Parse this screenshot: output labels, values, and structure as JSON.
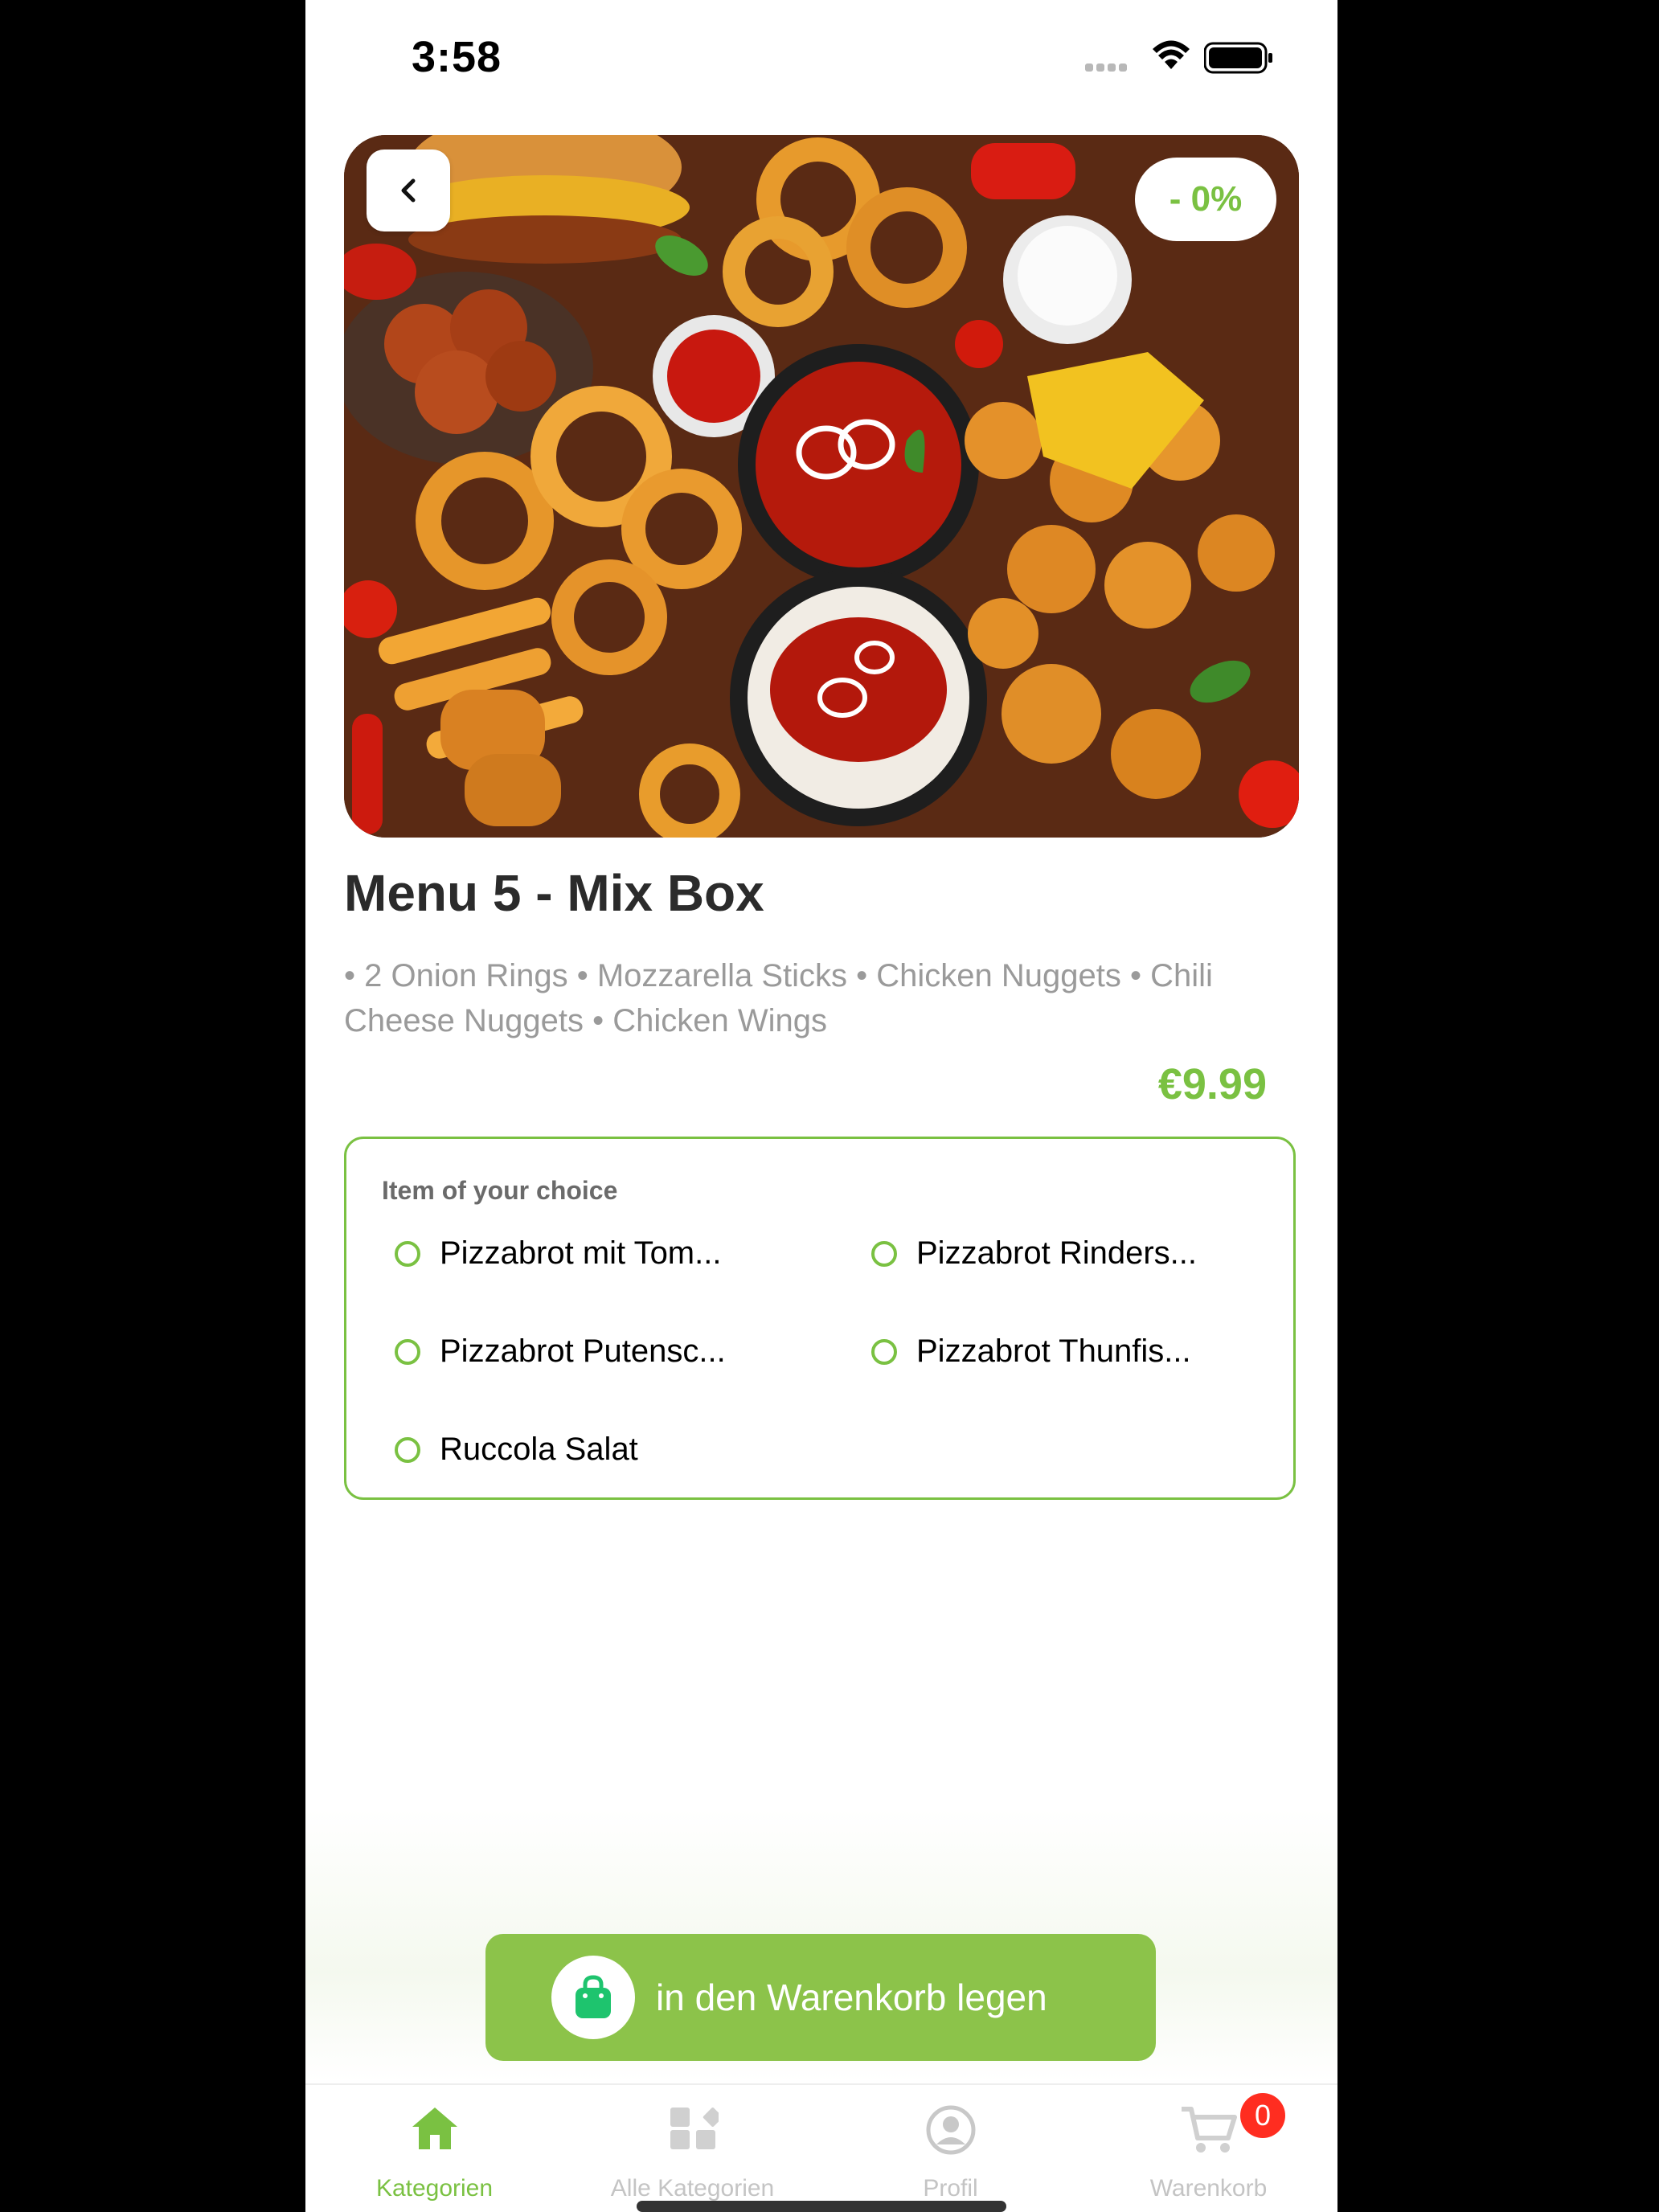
{
  "status_bar": {
    "time": "3:58",
    "icons": [
      "signal-icon",
      "wifi-icon",
      "battery-icon"
    ]
  },
  "product": {
    "discount_badge": "- 0%",
    "title": "Menu 5 - Mix Box",
    "description": "• 2 Onion Rings • Mozzarella Sticks • Chicken Nuggets • Chili Cheese Nuggets • Chicken Wings",
    "price": "€9.99"
  },
  "choices": {
    "title": "Item of your choice",
    "options": [
      "Pizzabrot mit Tom...",
      "Pizzabrot Rinders...",
      "Pizzabrot Putensc...",
      "Pizzabrot Thunfis...",
      "Ruccola Salat"
    ]
  },
  "cart_button": {
    "label": "in den Warenkorb legen",
    "icon": "shopping-bag-icon"
  },
  "tabbar": {
    "tabs": [
      {
        "label": "Kategorien",
        "icon": "home-icon",
        "active": true
      },
      {
        "label": "Alle Kategorien",
        "icon": "categories-icon",
        "active": false
      },
      {
        "label": "Profil",
        "icon": "profile-icon",
        "active": false
      },
      {
        "label": "Warenkorb",
        "icon": "cart-icon",
        "active": false
      }
    ],
    "cart_count": "0"
  },
  "colors": {
    "accent": "#7ac142",
    "button": "#8cc34a",
    "badge": "#ff2d20",
    "title": "#2b2b2b",
    "muted": "#9a9a9a"
  }
}
